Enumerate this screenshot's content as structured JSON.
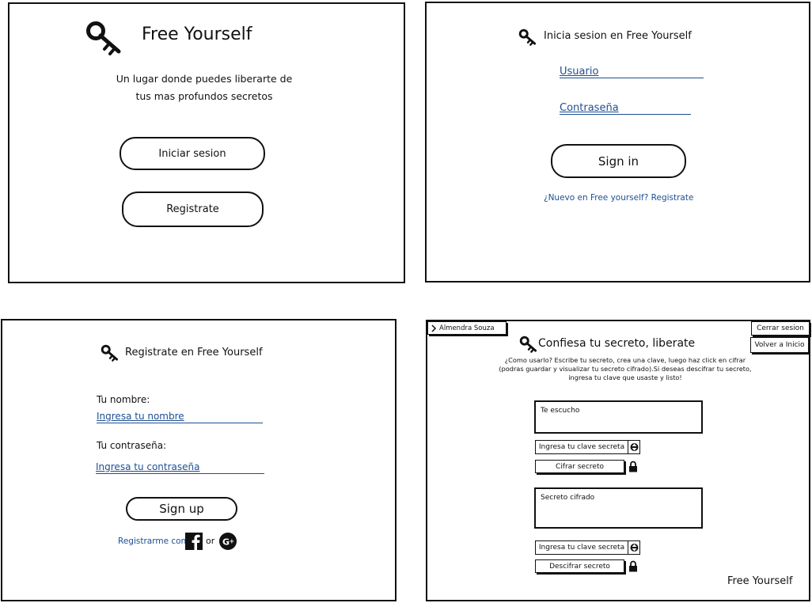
{
  "panel_welcome": {
    "title": "Free Yourself",
    "tagline_line1": "Un lugar donde puedes liberarte de",
    "tagline_line2": "tus mas profundos secretos",
    "login_button": "Iniciar sesion",
    "register_button": "Registrate"
  },
  "panel_login": {
    "title": "Inicia sesion en Free Yourself",
    "username_placeholder": "Usuario",
    "password_placeholder": "Contraseña",
    "signin_button": "Sign in",
    "register_link": "¿Nuevo en Free yourself? Registrate"
  },
  "panel_register": {
    "title": "Registrate en Free Yourself",
    "name_label": "Tu nombre:",
    "name_placeholder": "Ingresa tu nombre",
    "password_label": "Tu contraseña:",
    "password_placeholder": "Ingresa tu contraseña",
    "signup_button": "Sign up",
    "social_prefix": "Registrarme con",
    "social_or": "or"
  },
  "panel_secret": {
    "user_name": "Almendra Souza",
    "logout_button": "Cerrar sesion",
    "home_button": "Volver a Inicio",
    "title": "Confiesa tu secreto, liberate",
    "help_line1": "¿Como usarlo? Escribe tu secreto, crea una clave, luego haz click en cifrar",
    "help_line2": "(podras guardar y visualizar tu secreto cifrado).Si deseas descifrar tu secreto,",
    "help_line3": "ingresa tu clave que usaste y listo!",
    "secret_placeholder": "Te escucho",
    "key_select_1": "Ingresa tu clave secreta",
    "encrypt_button": "Cifrar secreto",
    "cipher_placeholder": "Secreto cifrado",
    "key_select_2": "Ingresa tu clave secreta",
    "decrypt_button": "Descifrar secreto",
    "brand_footer": "Free Yourself"
  },
  "icons": {
    "brand": "key-icon",
    "encrypt": "lock-icon",
    "decrypt": "lock-icon",
    "social_1": "facebook-icon",
    "social_2": "google-plus-icon",
    "user_toggle": "chevron-right-icon",
    "select_toggle": "up-down-arrows-icon"
  },
  "colors": {
    "link_blue": "#1d4f91",
    "ink": "#111111"
  }
}
